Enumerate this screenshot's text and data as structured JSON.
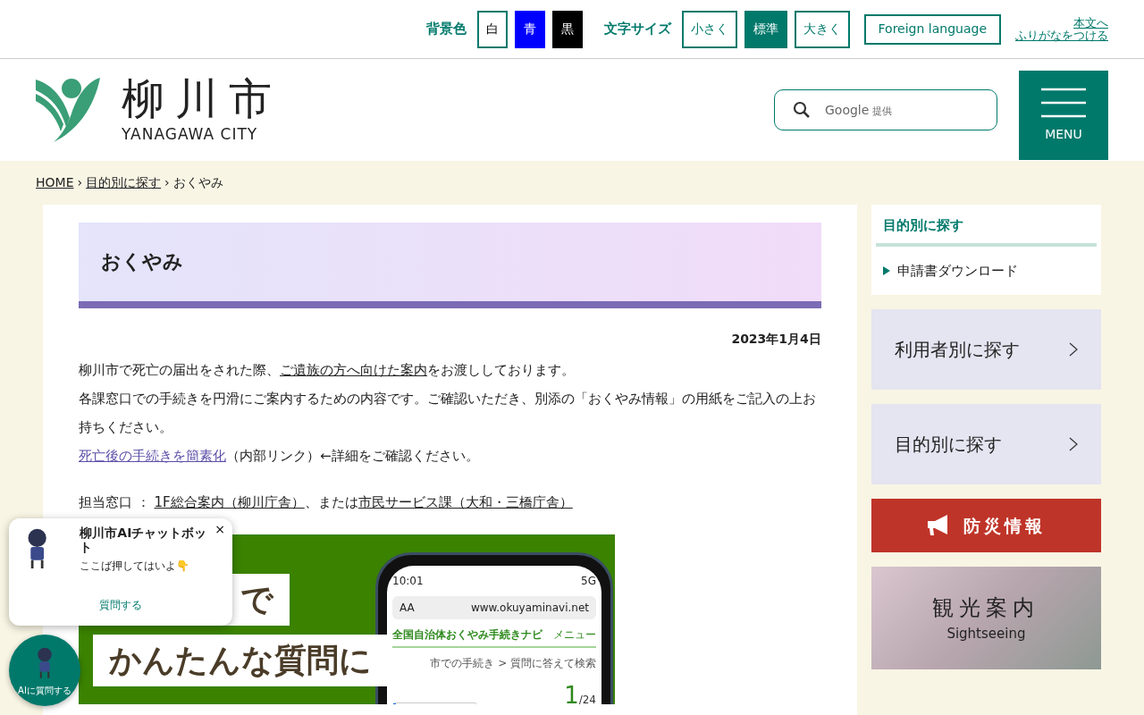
{
  "toolbar": {
    "bg_label": "背景色",
    "bg_options": [
      {
        "label": "白",
        "kind": "white",
        "selected": false
      },
      {
        "label": "青",
        "kind": "blue",
        "selected": false
      },
      {
        "label": "黒",
        "kind": "black",
        "selected": false
      }
    ],
    "size_label": "文字サイズ",
    "size_options": [
      {
        "label": "小さく",
        "selected": false
      },
      {
        "label": "標準",
        "selected": true
      },
      {
        "label": "大きく",
        "selected": false
      }
    ],
    "foreign": "Foreign language",
    "skip_link": "本文へ",
    "furigana": "ふりがなをつける"
  },
  "header": {
    "logo_name": "柳川市",
    "logo_sub": "YANAGAWA CITY",
    "search_brand": "Google",
    "search_note": "提供",
    "menu": "MENU"
  },
  "breadcrumb": [
    {
      "label": "HOME",
      "kind": "link"
    },
    {
      "separator": "›",
      "label": "目的別に探す",
      "kind": "link"
    },
    {
      "separator": "›",
      "label": "おくやみ",
      "kind": "current"
    }
  ],
  "page": {
    "title": "おくやみ",
    "date": "2023年1月4日",
    "paragraphs": [
      [
        {
          "text": "柳川市で死亡の届出をされた際、",
          "kind": "text"
        },
        {
          "text": "ご遺族の方へ向けた案内",
          "kind": "link"
        },
        {
          "text": "をお渡ししております。",
          "kind": "text"
        }
      ],
      [
        {
          "text": "各課窓口での手続きを円滑にご案内するための内容です。ご確認いただき、別添の「おくやみ情報」の用紙をご記入の上お持ちください。",
          "kind": "text"
        }
      ],
      [
        {
          "text": "死亡後の手続きを簡素化",
          "kind": "visited_link"
        },
        {
          "text": "（内部リンク）←詳細をご確認ください。",
          "kind": "text"
        }
      ]
    ],
    "contact": [
      {
        "text": "担当窓口 ： ",
        "kind": "text"
      },
      {
        "text": "1F総合案内（柳川庁舎）",
        "kind": "link"
      },
      {
        "text": "、または",
        "kind": "text"
      },
      {
        "text": "市民サービス課（大和・三橋庁舎）",
        "kind": "link"
      }
    ],
    "banner": {
      "headline": [
        "で",
        "かんたんな質問に"
      ],
      "phone": {
        "time": "10:01",
        "network": "5G",
        "aa": "AA",
        "url": "www.okuyaminavi.net",
        "site": "全国自治体おくやみ手続きナビ",
        "menu": "メニュー",
        "crumb": "市での手続き > 質問に答えて検索",
        "counter": "1",
        "total": "/24",
        "level": 0.03
      }
    }
  },
  "sidebar": {
    "local_title": "目的別に探す",
    "local_items": [
      "申請書ダウンロード"
    ],
    "big_links": [
      "利用者別に探す",
      "目的別に探す"
    ],
    "disaster": "防災情報",
    "sightseeing": {
      "title": "観光案内",
      "sub": "Sightseeing"
    }
  },
  "chatbot": {
    "title": "柳川市AIチャットボット",
    "close": "×",
    "message": "ここば押してはいよ👇",
    "action": "質問する",
    "launcher": "AIに質問する"
  }
}
